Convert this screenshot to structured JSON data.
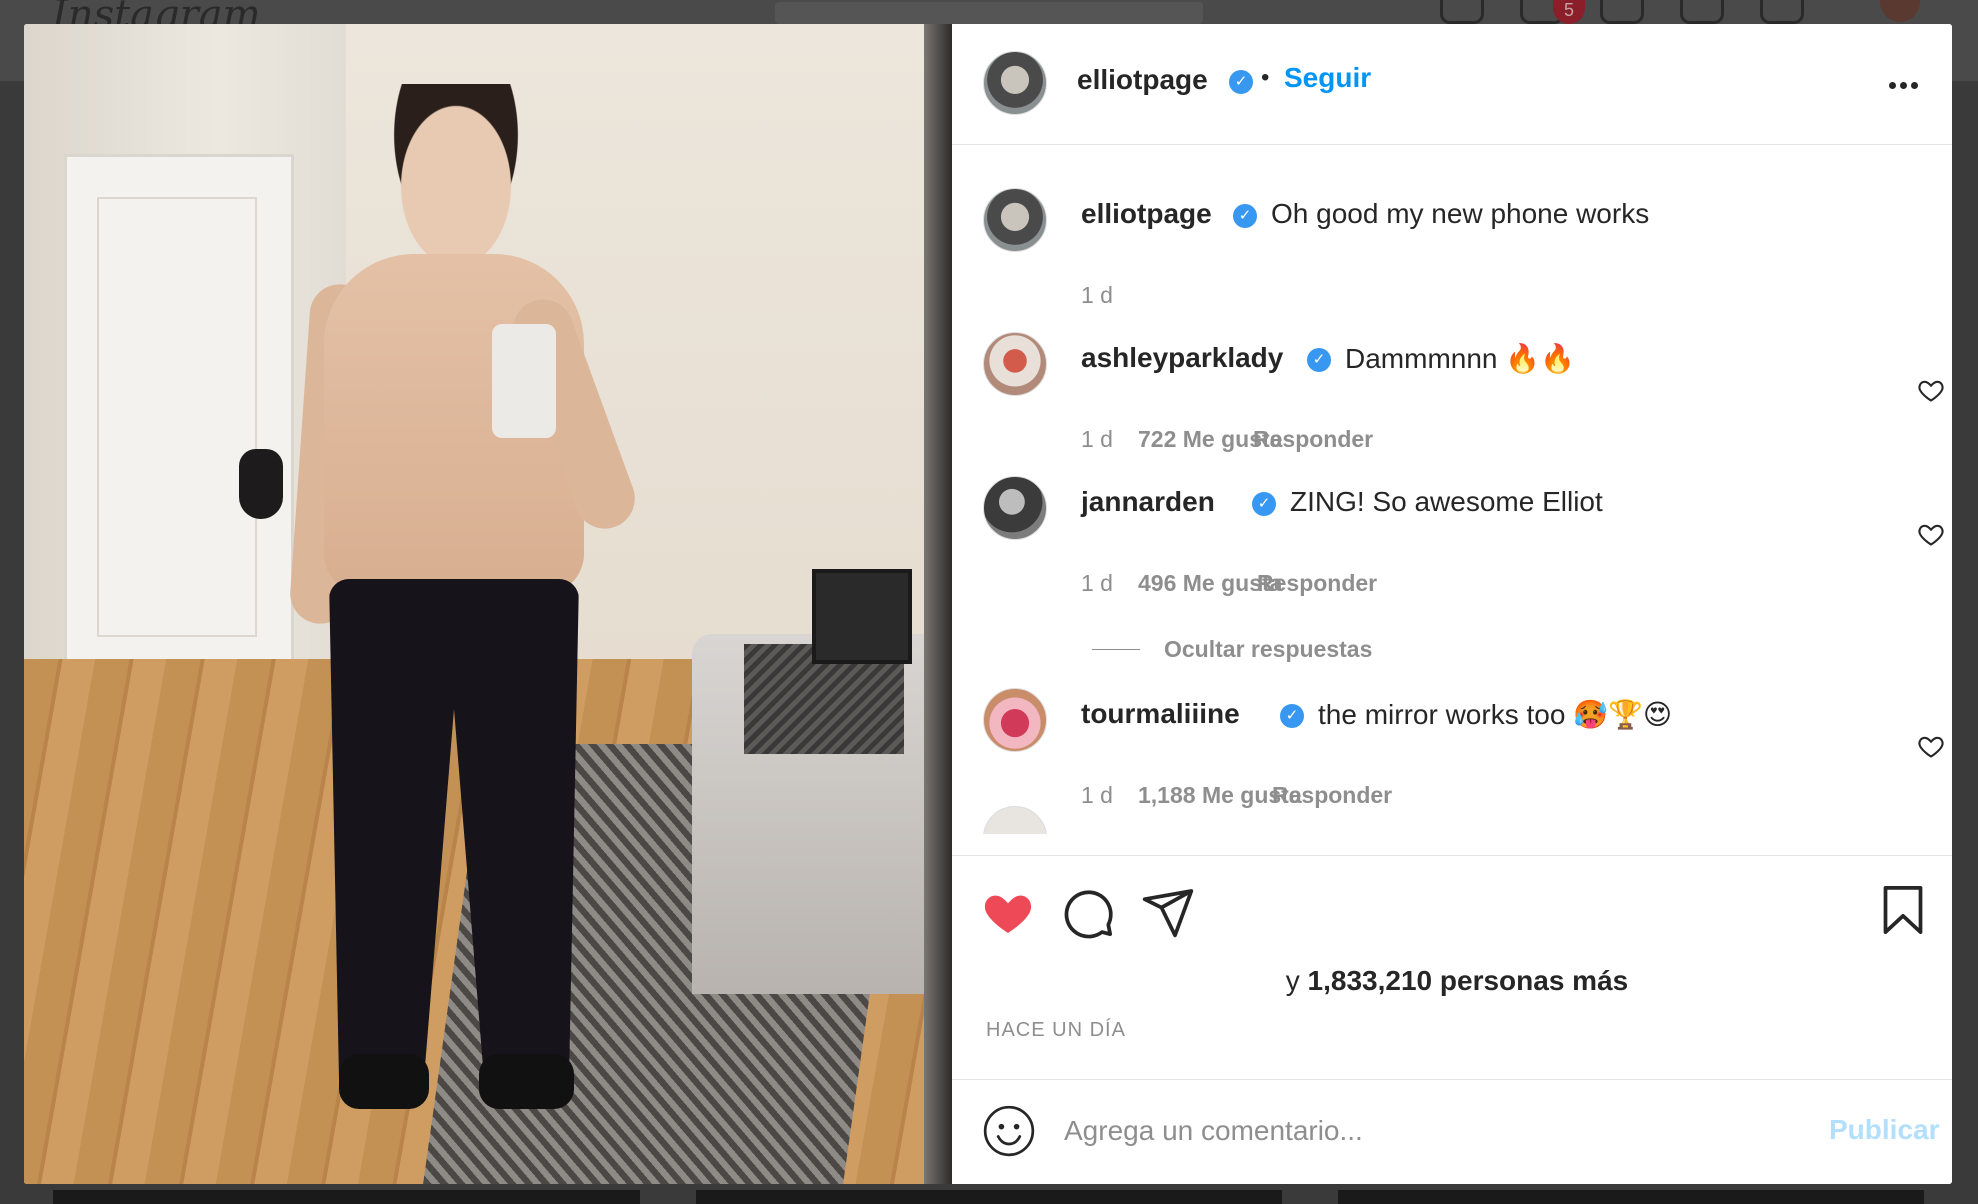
{
  "background": {
    "logo": "Instagram",
    "notifications_badge": "5"
  },
  "post": {
    "author": {
      "username": "elliotpage",
      "verified": true
    },
    "follow_label": "Seguir",
    "caption": {
      "username": "elliotpage",
      "text": "Oh good my new phone works",
      "time": "1 d"
    },
    "comments": [
      {
        "username": "ashleyparklady",
        "text": "Dammmnnn 🔥🔥",
        "time": "1 d",
        "likes": "722 Me gusta",
        "reply_label": "Responder"
      },
      {
        "username": "jannarden",
        "text": "ZING! So awesome Elliot",
        "time": "1 d",
        "likes": "496 Me gusta",
        "reply_label": "Responder"
      },
      {
        "username": "tourmaliiine",
        "text": "the mirror works too 🥵🏆😍",
        "time": "1 d",
        "likes": "1,188 Me gusta",
        "reply_label": "Responder"
      }
    ],
    "hide_replies_label": "Ocultar respuestas",
    "likes_summary": {
      "prefix": "y",
      "count_text": "1,833,210 personas más"
    },
    "time_ago": "HACE UN DÍA",
    "composer": {
      "placeholder": "Agrega un comentario...",
      "publish_label": "Publicar"
    }
  },
  "colors": {
    "accent": "#0095f6",
    "verified": "#3897f0",
    "liked_heart": "#ed4956",
    "publish_disabled": "#b2dffc",
    "muted_text": "#8e8e8e"
  },
  "icons": {
    "like": "heart-filled-icon",
    "comment": "comment-icon",
    "share": "paper-plane-icon",
    "save": "bookmark-icon",
    "emoji": "emoji-icon",
    "more": "more-options-icon"
  }
}
